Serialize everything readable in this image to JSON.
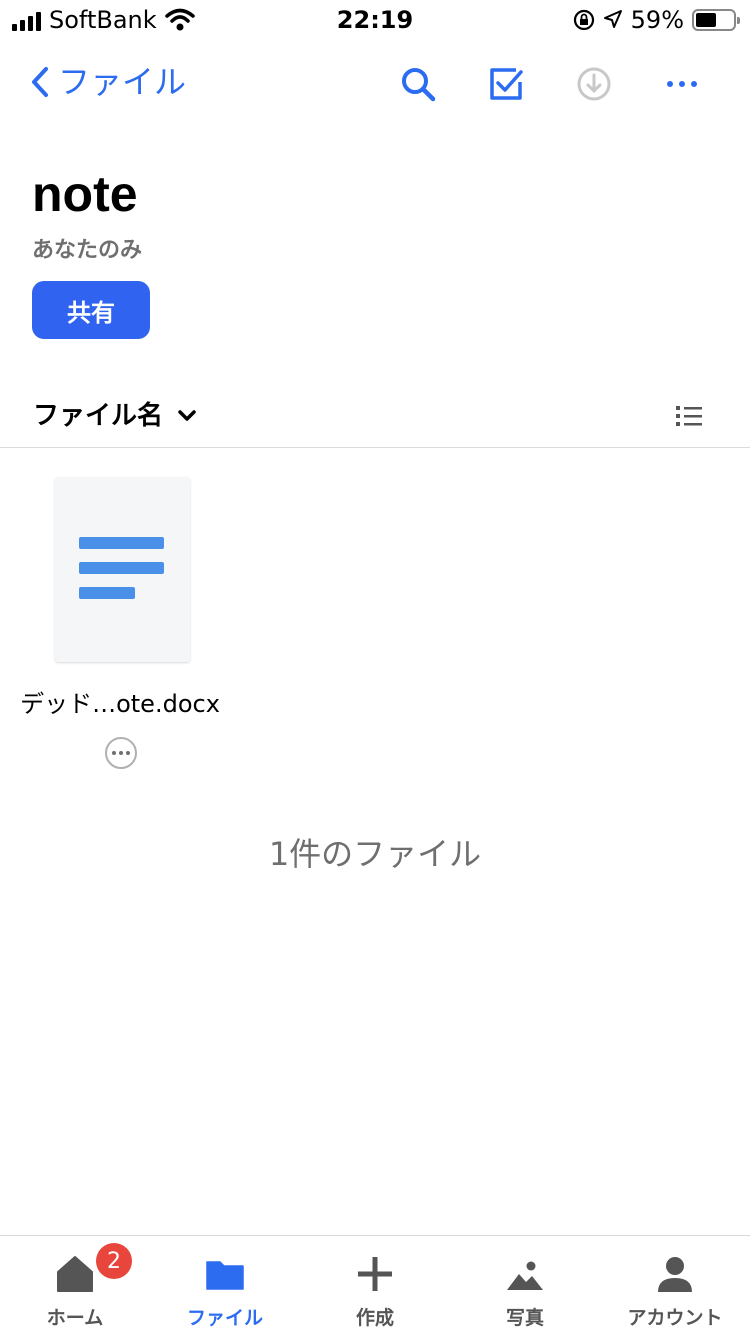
{
  "status_bar": {
    "carrier": "SoftBank",
    "time": "22:19",
    "battery_percent": "59%",
    "battery_level": 0.59
  },
  "nav": {
    "back_label": "ファイル",
    "icons": [
      "search-icon",
      "select-icon",
      "download-icon",
      "more-icon"
    ],
    "accent_color": "#2c6cf0"
  },
  "folder": {
    "title": "note",
    "owner": "あなたのみ",
    "share_label": "共有"
  },
  "sort": {
    "label": "ファイル名"
  },
  "files": [
    {
      "name": "デッド…ote.docx",
      "icon": "document-icon"
    }
  ],
  "file_count": "1件のファイル",
  "tab_bar": {
    "tabs": [
      {
        "label": "ホーム",
        "icon": "home-icon",
        "badge": "2"
      },
      {
        "label": "ファイル",
        "icon": "folder-icon",
        "active": true
      },
      {
        "label": "作成",
        "icon": "plus-icon"
      },
      {
        "label": "写真",
        "icon": "photo-icon"
      },
      {
        "label": "アカウント",
        "icon": "account-icon"
      }
    ]
  }
}
